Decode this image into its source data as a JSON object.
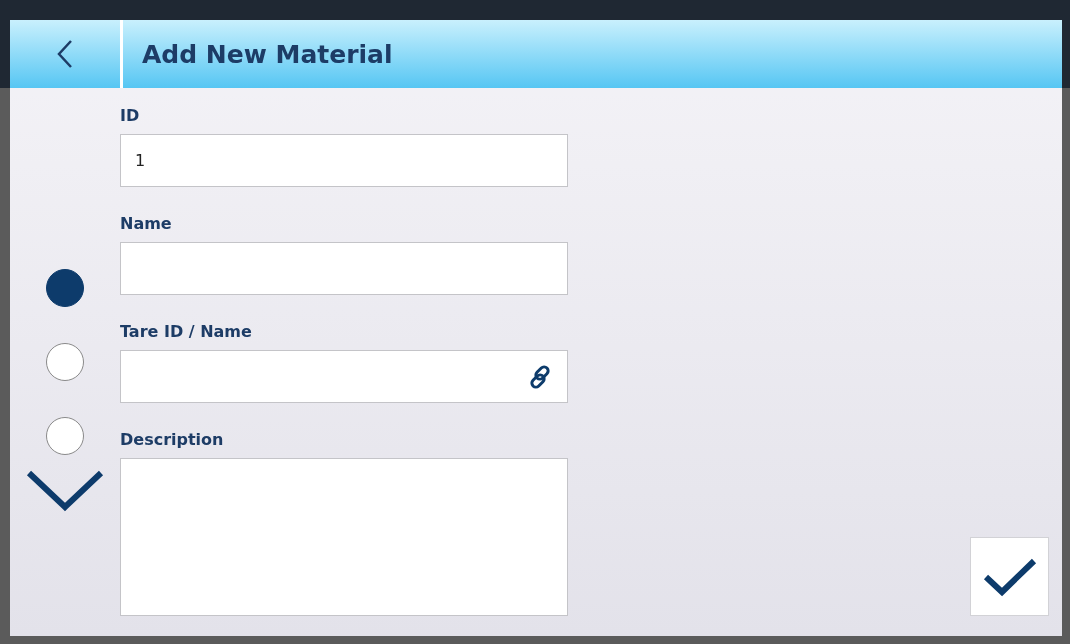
{
  "header": {
    "title": "Add New Material"
  },
  "page_indicator": [
    {
      "selected": true
    },
    {
      "selected": false
    },
    {
      "selected": false
    }
  ],
  "fields": [
    {
      "label": "ID",
      "kind": "text",
      "value": "1"
    },
    {
      "label": "Name",
      "kind": "text"
    },
    {
      "label": "Tare ID / Name",
      "kind": "link"
    },
    {
      "label": "Description",
      "kind": "multiline"
    }
  ]
}
